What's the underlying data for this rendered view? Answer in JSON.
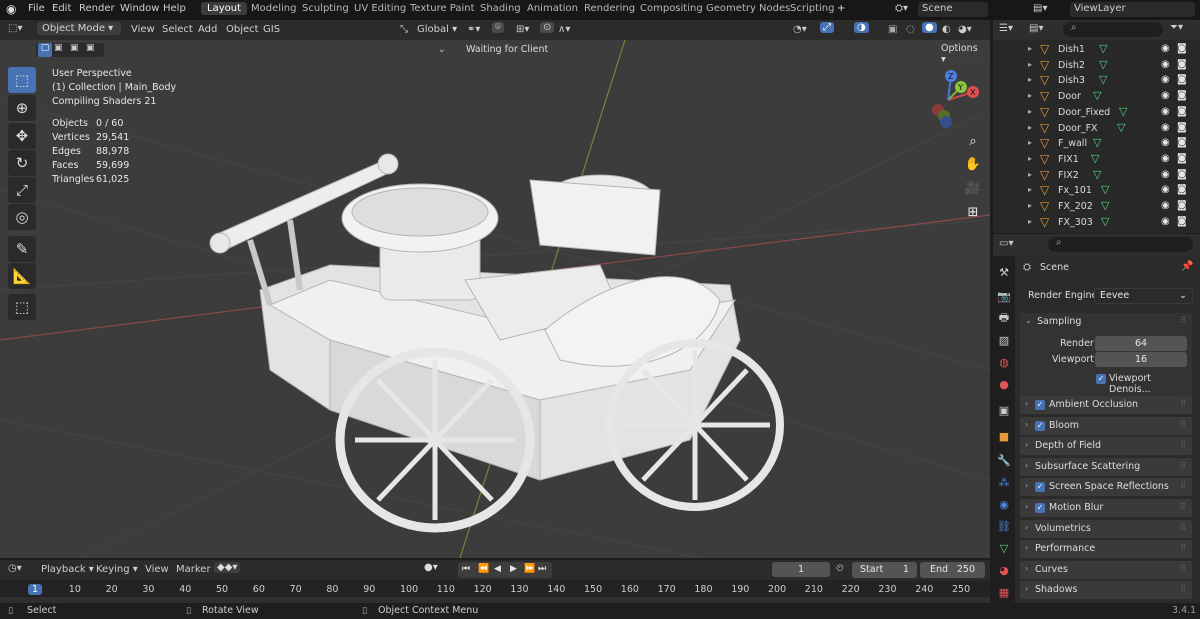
{
  "topbar": {
    "menus": [
      "File",
      "Edit",
      "Render",
      "Window",
      "Help"
    ],
    "workspaces": [
      "Layout",
      "Modeling",
      "Sculpting",
      "UV Editing",
      "Texture Paint",
      "Shading",
      "Animation",
      "Rendering",
      "Compositing",
      "Geometry Nodes",
      "Scripting"
    ],
    "active_workspace": "Layout",
    "add_tab": "+",
    "scene": "Scene",
    "view_layer": "ViewLayer"
  },
  "viewport_header": {
    "mode": "Object Mode",
    "menus": [
      "View",
      "Select",
      "Add",
      "Object",
      "GIS"
    ],
    "transform_orientation": "Global",
    "status": "Waiting for Client",
    "options": "Options"
  },
  "viewport_overlay": {
    "perspective": "User Perspective",
    "collection": "(1) Collection | Main_Body",
    "compiling": "Compiling Shaders 21",
    "stats": [
      {
        "label": "Objects",
        "value": "0 / 60"
      },
      {
        "label": "Vertices",
        "value": "29,541"
      },
      {
        "label": "Edges",
        "value": "88,978"
      },
      {
        "label": "Faces",
        "value": "59,699"
      },
      {
        "label": "Triangles",
        "value": "61,025"
      }
    ],
    "gizmo": {
      "x": "X",
      "y": "Y",
      "z": "Z"
    }
  },
  "outliner": {
    "items": [
      "Dish1",
      "Dish2",
      "Dish3",
      "Door",
      "Door_Fixed",
      "Door_FX",
      "F_wall",
      "FIX1",
      "FIX2",
      "Fx_101",
      "FX_202",
      "FX_303"
    ]
  },
  "properties": {
    "context": "Scene",
    "render_engine_label": "Render Engine",
    "render_engine": "Eevee",
    "sampling": {
      "title": "Sampling",
      "render_label": "Render",
      "render_value": "64",
      "viewport_label": "Viewport",
      "viewport_value": "16",
      "denoise": "Viewport Denois..."
    },
    "panels": [
      {
        "label": "Ambient Occlusion",
        "checkbox": true
      },
      {
        "label": "Bloom",
        "checkbox": true
      },
      {
        "label": "Depth of Field",
        "checkbox": false
      },
      {
        "label": "Subsurface Scattering",
        "checkbox": false
      },
      {
        "label": "Screen Space Reflections",
        "checkbox": true
      },
      {
        "label": "Motion Blur",
        "checkbox": true
      },
      {
        "label": "Volumetrics",
        "checkbox": false
      },
      {
        "label": "Performance",
        "checkbox": false
      },
      {
        "label": "Curves",
        "checkbox": false
      },
      {
        "label": "Shadows",
        "checkbox": false
      }
    ]
  },
  "timeline": {
    "menus": [
      "Playback",
      "Keying",
      "View",
      "Marker"
    ],
    "current_frame": "1",
    "start_label": "Start",
    "start": "1",
    "end_label": "End",
    "end": "250",
    "ticks": [
      "1",
      "10",
      "20",
      "30",
      "40",
      "50",
      "60",
      "70",
      "80",
      "90",
      "100",
      "110",
      "120",
      "130",
      "140",
      "150",
      "160",
      "170",
      "180",
      "190",
      "200",
      "210",
      "220",
      "230",
      "240",
      "250"
    ]
  },
  "statusbar": {
    "select": "Select",
    "rotate": "Rotate View",
    "context_menu": "Object Context Menu",
    "version": "3.4.1"
  },
  "colors": {
    "accent": "#4772b3",
    "viewport_bg": "#3c3c3c",
    "object_icon": "#e89a3c",
    "mesh_icon": "#5ad17f"
  }
}
